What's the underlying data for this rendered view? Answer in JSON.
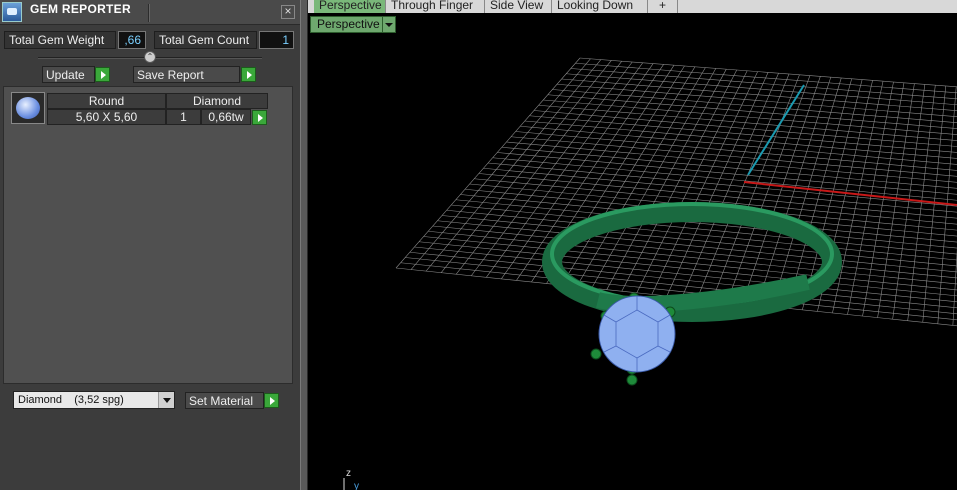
{
  "panel": {
    "title": "GEM REPORTER",
    "close_glyph": "×",
    "total_weight_label": "Total Gem Weight",
    "total_weight_value": ",66",
    "total_count_label": "Total Gem Count",
    "total_count_value": "1",
    "update_label": "Update",
    "save_report_label": "Save Report",
    "collapse_glyph": "⌃"
  },
  "gem_table": {
    "headers": [
      "Round",
      "Diamond"
    ],
    "rows": [
      {
        "size": "5,60 X 5,60",
        "count": "1",
        "weight": "0,66tw"
      }
    ]
  },
  "material": {
    "selected": "Diamond    (3,52 spg)",
    "set_label": "Set Material"
  },
  "viewport": {
    "tabs": [
      "Perspective",
      "Through Finger",
      "Side View",
      "Looking Down",
      "+"
    ],
    "active_tab": "Perspective",
    "view_dropdown": "Perspective",
    "axis_z": "z",
    "axis_y": "y"
  },
  "colors": {
    "accent_green": "#3aa83a",
    "ring_green": "#1e7a4a",
    "gem_blue": "#8fb0f0",
    "value_blue": "#7ad0ff"
  }
}
